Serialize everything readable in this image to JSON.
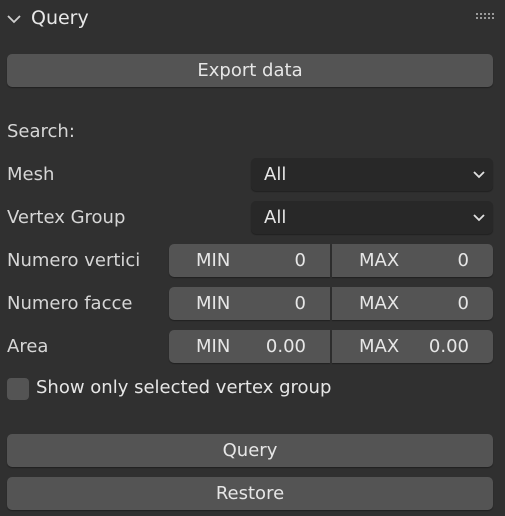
{
  "panel": {
    "title": "Query",
    "collapse_icon": "chevron-down-icon",
    "drag_icon": "grip-dots-icon"
  },
  "buttons": {
    "export": "Export data",
    "query": "Query",
    "restore": "Restore"
  },
  "search": {
    "heading": "Search:",
    "mesh": {
      "label": "Mesh",
      "value": "All"
    },
    "vertex_group": {
      "label": "Vertex Group",
      "value": "All"
    },
    "numero_vertici": {
      "label": "Numero vertici",
      "min_label": "MIN",
      "min": "0",
      "max_label": "MAX",
      "max": "0"
    },
    "numero_facce": {
      "label": "Numero facce",
      "min_label": "MIN",
      "min": "0",
      "max_label": "MAX",
      "max": "0"
    },
    "area": {
      "label": "Area",
      "min_label": "MIN",
      "min": "0.00",
      "max_label": "MAX",
      "max": "0.00"
    },
    "show_selected": {
      "label": "Show only selected vertex group",
      "checked": false
    }
  },
  "colors": {
    "background": "#303030",
    "button": "#545454",
    "dropdown": "#282828",
    "text": "#e6e6e6"
  }
}
